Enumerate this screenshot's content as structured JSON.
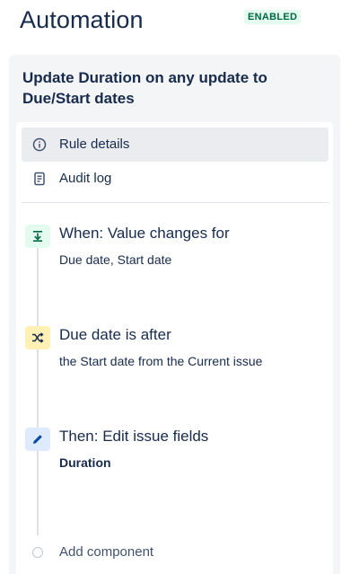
{
  "header": {
    "title": "Automation",
    "status": "ENABLED"
  },
  "rule": {
    "name": "Update Duration on any update to Due/Start dates"
  },
  "menu": {
    "items": [
      {
        "label": "Rule details",
        "icon": "info-icon",
        "selected": true
      },
      {
        "label": "Audit log",
        "icon": "document-icon",
        "selected": false
      }
    ]
  },
  "components": [
    {
      "title": "When: Value changes for",
      "description": "Due date, Start date",
      "icon": "trigger-download-icon",
      "color": "#e3fcef"
    },
    {
      "title": "Due date is after",
      "description": "the Start date from the Current issue",
      "icon": "shuffle-icon",
      "color": "#fff0b3"
    },
    {
      "title": "Then: Edit issue fields",
      "description": "Duration",
      "icon": "pencil-icon",
      "color": "#deebff"
    }
  ],
  "add_component": {
    "label": "Add component"
  },
  "colors": {
    "accent_green": "#006644",
    "text": "#172b4d",
    "panel_bg": "#f4f5f7"
  }
}
